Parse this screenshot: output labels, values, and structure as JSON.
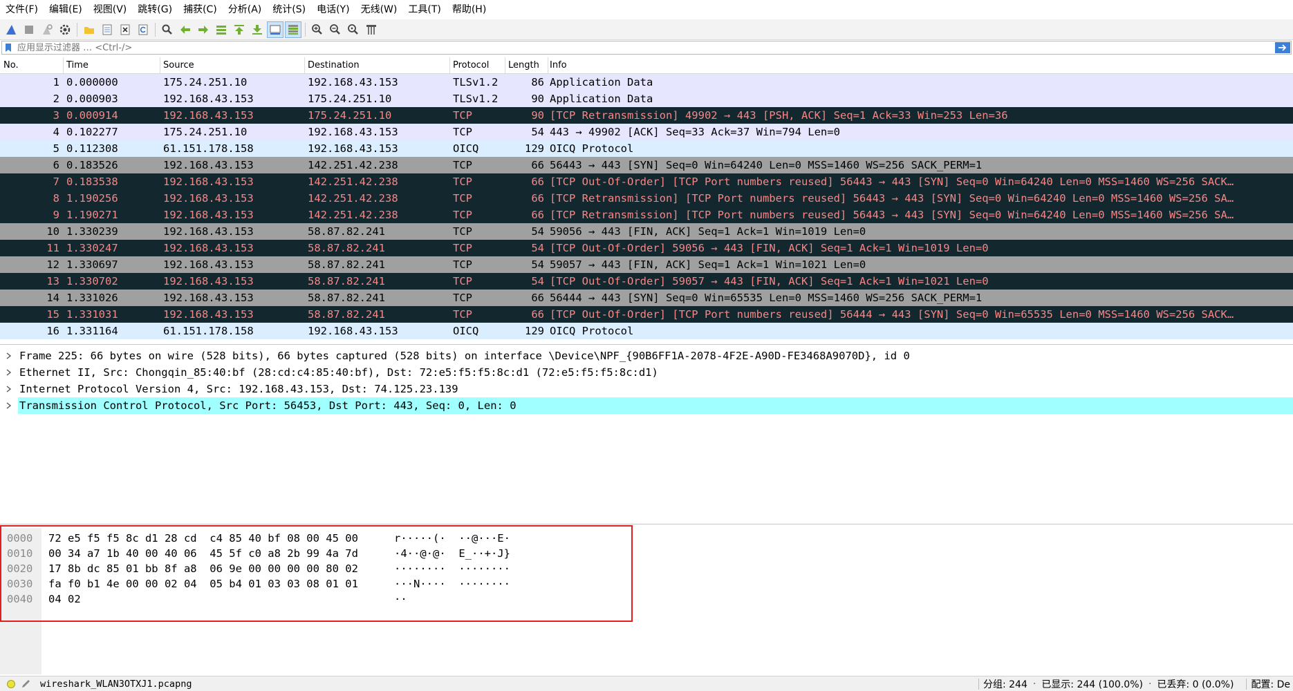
{
  "menu": [
    {
      "label": "文件(F)"
    },
    {
      "label": "编辑(E)"
    },
    {
      "label": "视图(V)"
    },
    {
      "label": "跳转(G)"
    },
    {
      "label": "捕获(C)"
    },
    {
      "label": "分析(A)"
    },
    {
      "label": "统计(S)"
    },
    {
      "label": "电话(Y)"
    },
    {
      "label": "无线(W)"
    },
    {
      "label": "工具(T)"
    },
    {
      "label": "帮助(H)"
    }
  ],
  "filter": {
    "placeholder": "应用显示过滤器 … <Ctrl-/>"
  },
  "colors": {
    "lavender": "#e7e6ff",
    "lightblue": "#daeeff",
    "gray": "#a0a0a0",
    "dark": "#12272e",
    "darkfg": "#f78787",
    "cyan": "#a0ffff"
  },
  "columns": {
    "no": "No.",
    "time": "Time",
    "source": "Source",
    "destination": "Destination",
    "protocol": "Protocol",
    "length": "Length",
    "info": "Info"
  },
  "packets": [
    {
      "no": "1",
      "time": "0.000000",
      "src": "175.24.251.10",
      "dst": "192.168.43.153",
      "proto": "TLSv1.2",
      "len": "86",
      "info": "Application Data",
      "style": "lavender"
    },
    {
      "no": "2",
      "time": "0.000903",
      "src": "192.168.43.153",
      "dst": "175.24.251.10",
      "proto": "TLSv1.2",
      "len": "90",
      "info": "Application Data",
      "style": "lavender"
    },
    {
      "no": "3",
      "time": "0.000914",
      "src": "192.168.43.153",
      "dst": "175.24.251.10",
      "proto": "TCP",
      "len": "90",
      "info": "[TCP Retransmission] 49902 → 443 [PSH, ACK] Seq=1 Ack=33 Win=253 Len=36",
      "style": "dark"
    },
    {
      "no": "4",
      "time": "0.102277",
      "src": "175.24.251.10",
      "dst": "192.168.43.153",
      "proto": "TCP",
      "len": "54",
      "info": "443 → 49902 [ACK] Seq=33 Ack=37 Win=794 Len=0",
      "style": "lavender"
    },
    {
      "no": "5",
      "time": "0.112308",
      "src": "61.151.178.158",
      "dst": "192.168.43.153",
      "proto": "OICQ",
      "len": "129",
      "info": "OICQ Protocol",
      "style": "lightblue"
    },
    {
      "no": "6",
      "time": "0.183526",
      "src": "192.168.43.153",
      "dst": "142.251.42.238",
      "proto": "TCP",
      "len": "66",
      "info": "56443 → 443 [SYN] Seq=0 Win=64240 Len=0 MSS=1460 WS=256 SACK_PERM=1",
      "style": "gray"
    },
    {
      "no": "7",
      "time": "0.183538",
      "src": "192.168.43.153",
      "dst": "142.251.42.238",
      "proto": "TCP",
      "len": "66",
      "info": "[TCP Out-Of-Order] [TCP Port numbers reused] 56443 → 443 [SYN] Seq=0 Win=64240 Len=0 MSS=1460 WS=256 SACK…",
      "style": "dark"
    },
    {
      "no": "8",
      "time": "1.190256",
      "src": "192.168.43.153",
      "dst": "142.251.42.238",
      "proto": "TCP",
      "len": "66",
      "info": "[TCP Retransmission] [TCP Port numbers reused] 56443 → 443 [SYN] Seq=0 Win=64240 Len=0 MSS=1460 WS=256 SA…",
      "style": "dark"
    },
    {
      "no": "9",
      "time": "1.190271",
      "src": "192.168.43.153",
      "dst": "142.251.42.238",
      "proto": "TCP",
      "len": "66",
      "info": "[TCP Retransmission] [TCP Port numbers reused] 56443 → 443 [SYN] Seq=0 Win=64240 Len=0 MSS=1460 WS=256 SA…",
      "style": "dark"
    },
    {
      "no": "10",
      "time": "1.330239",
      "src": "192.168.43.153",
      "dst": "58.87.82.241",
      "proto": "TCP",
      "len": "54",
      "info": "59056 → 443 [FIN, ACK] Seq=1 Ack=1 Win=1019 Len=0",
      "style": "gray"
    },
    {
      "no": "11",
      "time": "1.330247",
      "src": "192.168.43.153",
      "dst": "58.87.82.241",
      "proto": "TCP",
      "len": "54",
      "info": "[TCP Out-Of-Order] 59056 → 443 [FIN, ACK] Seq=1 Ack=1 Win=1019 Len=0",
      "style": "dark"
    },
    {
      "no": "12",
      "time": "1.330697",
      "src": "192.168.43.153",
      "dst": "58.87.82.241",
      "proto": "TCP",
      "len": "54",
      "info": "59057 → 443 [FIN, ACK] Seq=1 Ack=1 Win=1021 Len=0",
      "style": "gray"
    },
    {
      "no": "13",
      "time": "1.330702",
      "src": "192.168.43.153",
      "dst": "58.87.82.241",
      "proto": "TCP",
      "len": "54",
      "info": "[TCP Out-Of-Order] 59057 → 443 [FIN, ACK] Seq=1 Ack=1 Win=1021 Len=0",
      "style": "dark"
    },
    {
      "no": "14",
      "time": "1.331026",
      "src": "192.168.43.153",
      "dst": "58.87.82.241",
      "proto": "TCP",
      "len": "66",
      "info": "56444 → 443 [SYN] Seq=0 Win=65535 Len=0 MSS=1460 WS=256 SACK_PERM=1",
      "style": "gray"
    },
    {
      "no": "15",
      "time": "1.331031",
      "src": "192.168.43.153",
      "dst": "58.87.82.241",
      "proto": "TCP",
      "len": "66",
      "info": "[TCP Out-Of-Order] [TCP Port numbers reused] 56444 → 443 [SYN] Seq=0 Win=65535 Len=0 MSS=1460 WS=256 SACK…",
      "style": "dark"
    },
    {
      "no": "16",
      "time": "1.331164",
      "src": "61.151.178.158",
      "dst": "192.168.43.153",
      "proto": "OICQ",
      "len": "129",
      "info": "OICQ Protocol",
      "style": "lightblue"
    }
  ],
  "details": [
    {
      "text": "Frame 225: 66 bytes on wire (528 bits), 66 bytes captured (528 bits) on interface \\Device\\NPF_{90B6FF1A-2078-4F2E-A90D-FE3468A9070D}, id 0",
      "selected": false
    },
    {
      "text": "Ethernet II, Src: Chongqin_85:40:bf (28:cd:c4:85:40:bf), Dst: 72:e5:f5:f5:8c:d1 (72:e5:f5:f5:8c:d1)",
      "selected": false
    },
    {
      "text": "Internet Protocol Version 4, Src: 192.168.43.153, Dst: 74.125.23.139",
      "selected": false
    },
    {
      "text": "Transmission Control Protocol, Src Port: 56453, Dst Port: 443, Seq: 0, Len: 0",
      "selected": true
    }
  ],
  "bytes": [
    {
      "offset": "0000",
      "hex": "72 e5 f5 f5 8c d1 28 cd  c4 85 40 bf 08 00 45 00",
      "ascii": "r·····(·  ··@···E·"
    },
    {
      "offset": "0010",
      "hex": "00 34 a7 1b 40 00 40 06  45 5f c0 a8 2b 99 4a 7d",
      "ascii": "·4··@·@·  E_··+·J}"
    },
    {
      "offset": "0020",
      "hex": "17 8b dc 85 01 bb 8f a8  06 9e 00 00 00 00 80 02",
      "ascii": "········  ········"
    },
    {
      "offset": "0030",
      "hex": "fa f0 b1 4e 00 00 02 04  05 b4 01 03 03 08 01 01",
      "ascii": "···N····  ········"
    },
    {
      "offset": "0040",
      "hex": "04 02",
      "ascii": "··"
    }
  ],
  "status": {
    "file": "wireshark_WLAN3OTXJ1.pcapng",
    "packets": "分组: 244",
    "displayed": "已显示: 244 (100.0%)",
    "dropped": "已丢弃: 0 (0.0%)",
    "profile": "配置: De"
  }
}
